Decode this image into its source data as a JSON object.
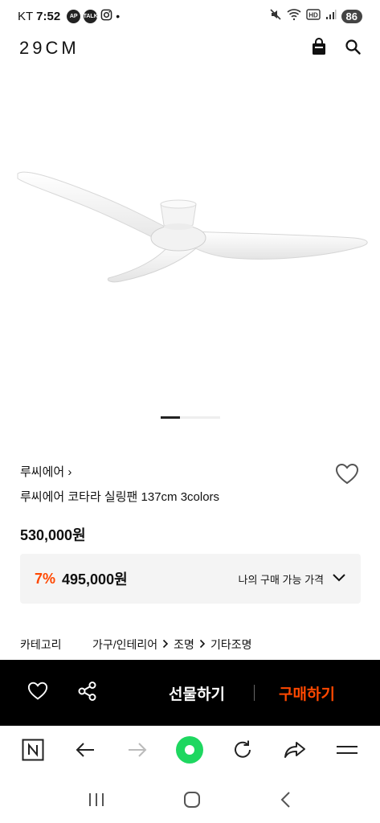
{
  "status_bar": {
    "carrier": "KT",
    "time": "7:52",
    "icon_labels": [
      "AP",
      "TALK"
    ],
    "dot": "•",
    "battery": "86"
  },
  "app": {
    "logo": "29CM"
  },
  "product": {
    "brand": "루씨에어 ›",
    "title": "루씨에어 코타라 실링팬 137cm 3colors",
    "price": "530,000원",
    "discount_percent": "7%",
    "discount_price": "495,000원",
    "my_price_label": "나의 구매 가능 가격"
  },
  "category": {
    "label": "카테고리",
    "path": [
      "가구/인테리어",
      "조명",
      "기타조명"
    ]
  },
  "buy_bar": {
    "gift_label": "선물하기",
    "buy_label": "구매하기"
  },
  "colors": {
    "accent": "#ff4800",
    "browser_green": "#1ed760"
  }
}
